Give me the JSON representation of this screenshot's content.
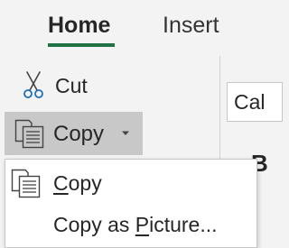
{
  "ribbon": {
    "tabs": [
      {
        "label": "Home",
        "active": true
      },
      {
        "label": "Insert",
        "active": false
      }
    ],
    "accent_color": "#217346"
  },
  "clipboard": {
    "cut": {
      "label": "Cut",
      "icon": "scissors-icon"
    },
    "copy": {
      "label": "Copy",
      "icon": "copy-icon",
      "dropdown_icon": "chevron-down-icon"
    }
  },
  "font": {
    "name_partial": "Cal",
    "obscured_char": "B"
  },
  "copy_menu": {
    "items": [
      {
        "prefix": "",
        "accel": "C",
        "suffix": "opy",
        "icon": "copy-icon"
      },
      {
        "prefix": "Copy as ",
        "accel": "P",
        "suffix": "icture...",
        "icon": ""
      }
    ]
  }
}
